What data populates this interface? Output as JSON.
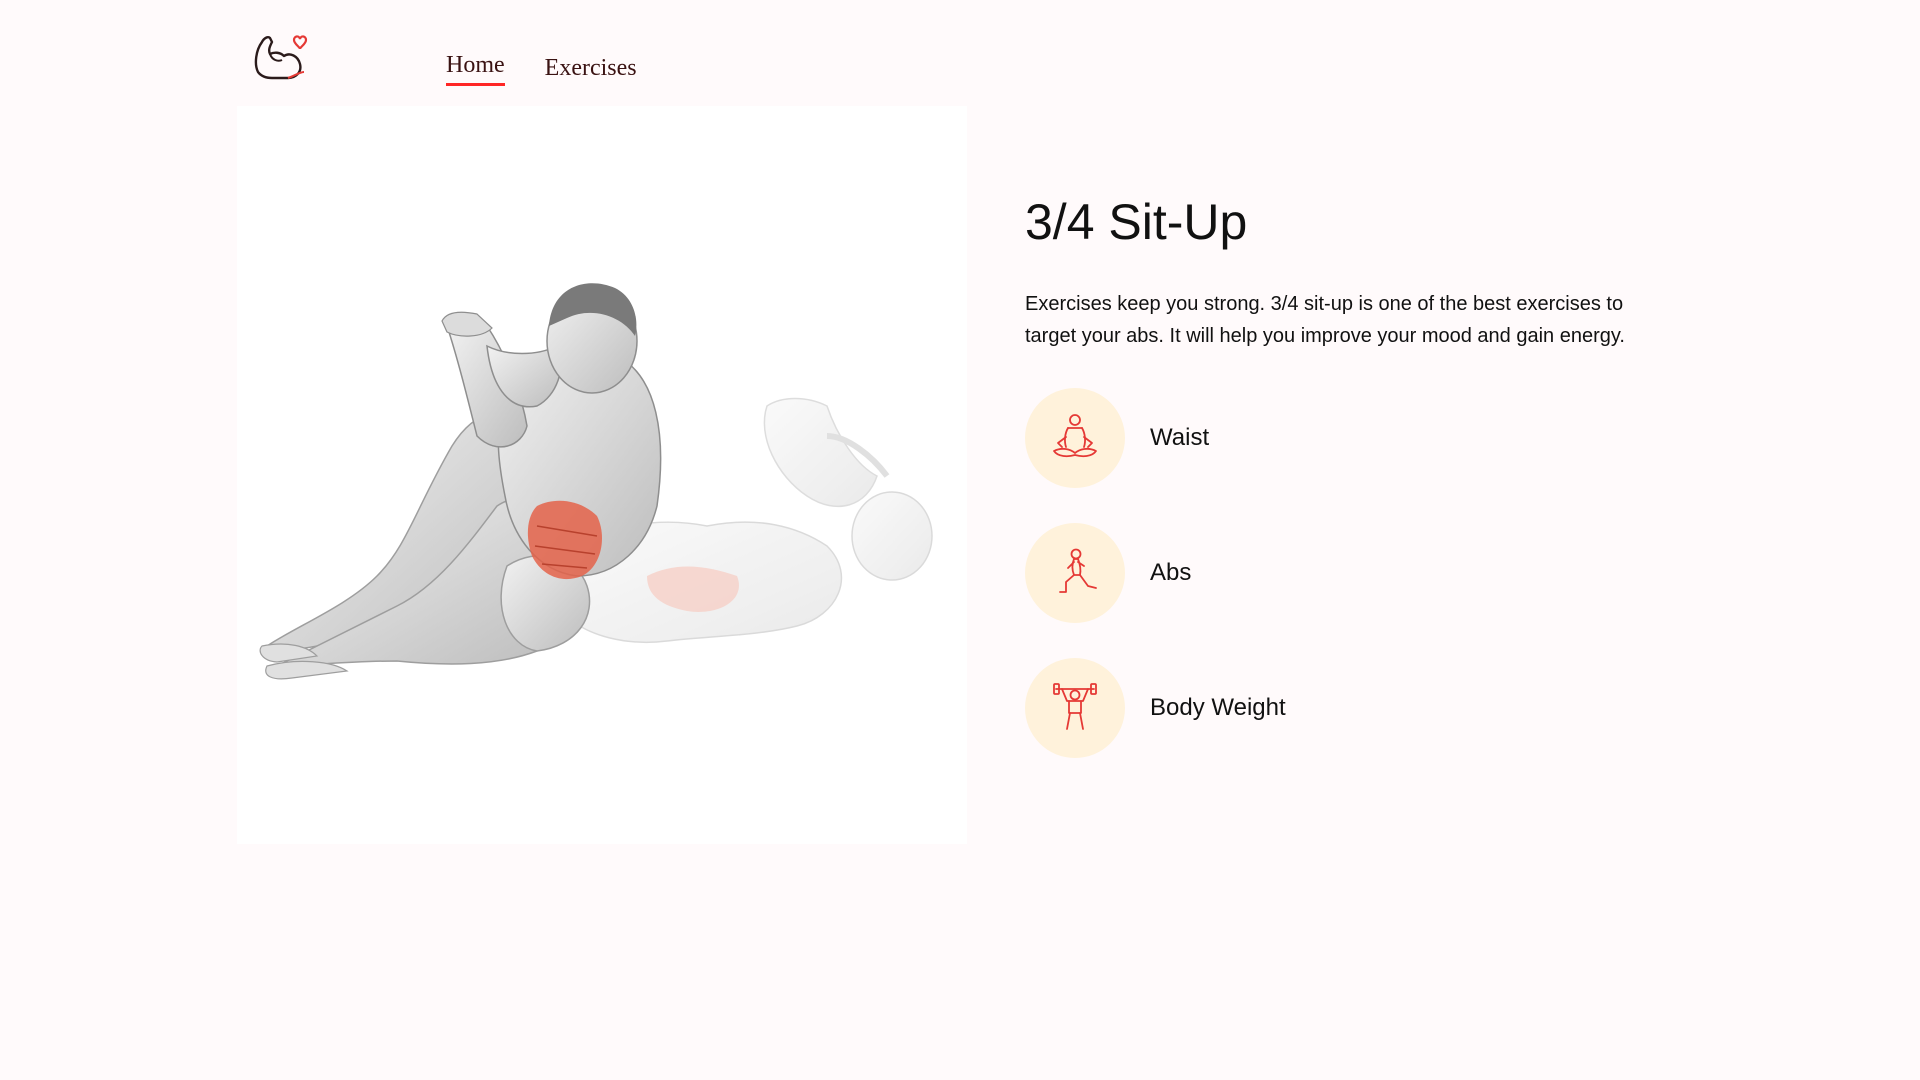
{
  "nav": {
    "logo_icon": "flexed-arm-heart-icon",
    "items": [
      {
        "label": "Home",
        "active": true
      },
      {
        "label": "Exercises",
        "active": false
      }
    ]
  },
  "exercise": {
    "image_icon": "sit-up-muscle-illustration",
    "title": "3/4 Sit-Up",
    "description": "Exercises keep you strong. 3/4 sit-up is one of the best exercises to target your abs. It will help you improve your mood and gain energy.",
    "targets": [
      {
        "label": "Waist",
        "icon": "meditation-pose-icon"
      },
      {
        "label": "Abs",
        "icon": "lunge-pose-icon"
      },
      {
        "label": "Body Weight",
        "icon": "weightlifter-icon"
      }
    ]
  },
  "colors": {
    "accent": "#ff2625",
    "icon_bg": "#fff2db",
    "page_bg": "#fffafb",
    "nav_text": "#3a1212"
  }
}
